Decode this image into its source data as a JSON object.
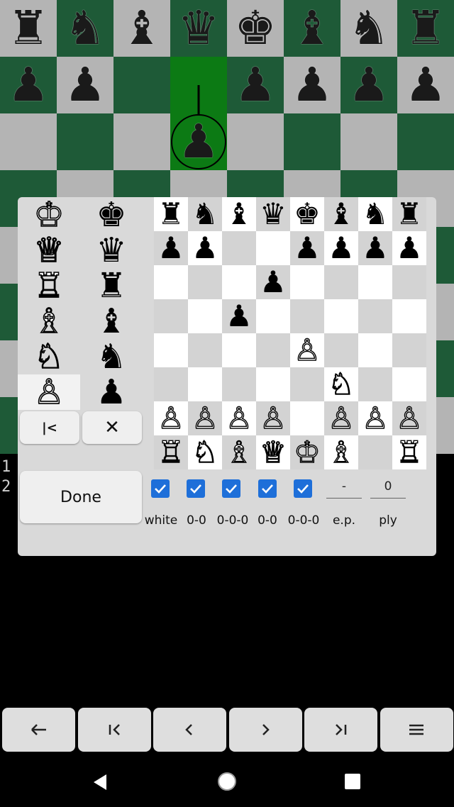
{
  "side_labels": [
    "1",
    "2"
  ],
  "palette": {
    "white": [
      "♔",
      "♕",
      "♖",
      "♗",
      "♘",
      "♙"
    ],
    "black": [
      "♚",
      "♛",
      "♜",
      "♝",
      "♞",
      "♟"
    ],
    "selected": "white-pawn"
  },
  "editor": {
    "first_button": "|<",
    "clear_button": "✕",
    "done_label": "Done",
    "checkboxes": [
      {
        "label": "white",
        "checked": true
      },
      {
        "label": "0-0",
        "checked": true
      },
      {
        "label": "0-0-0",
        "checked": true
      },
      {
        "label": "0-0",
        "checked": true
      },
      {
        "label": "0-0-0",
        "checked": true
      }
    ],
    "ep_label": "e.p.",
    "ep_value": "-",
    "ply_label": "ply",
    "ply_value": "0",
    "board": [
      [
        "♜",
        "♞",
        "♝",
        "♛",
        "♚",
        "♝",
        "♞",
        "♜"
      ],
      [
        "♟",
        "♟",
        "",
        "",
        "♟",
        "♟",
        "♟",
        "♟"
      ],
      [
        "",
        "",
        "",
        "♟",
        "",
        "",
        "",
        ""
      ],
      [
        "",
        "",
        "♟",
        "",
        "",
        "",
        "",
        ""
      ],
      [
        "",
        "",
        "",
        "",
        "♙",
        "",
        "",
        ""
      ],
      [
        "",
        "",
        "",
        "",
        "",
        "♘",
        "",
        ""
      ],
      [
        "♙",
        "♙",
        "♙",
        "♙",
        "",
        "♙",
        "♙",
        "♙"
      ],
      [
        "♖",
        "♘",
        "♗",
        "♕",
        "♔",
        "♗",
        "",
        "♖"
      ]
    ]
  },
  "background_board": {
    "rank8": [
      "♜",
      "♞",
      "♝",
      "♛",
      "♚",
      "♝",
      "♞",
      "♜"
    ],
    "rank7": [
      "♟",
      "♟",
      "",
      "",
      "♟",
      "♟",
      "♟",
      "♟"
    ],
    "rank6": [
      "",
      "",
      "",
      "♟",
      "",
      "",
      "",
      ""
    ]
  },
  "nav": [
    "arrow-left",
    "jump-start",
    "prev",
    "next",
    "jump-end",
    "menu"
  ],
  "colors": {
    "checkbox": "#1e6fd9",
    "highlight": "#0c7a14",
    "dark_square": "#1e5a37"
  }
}
